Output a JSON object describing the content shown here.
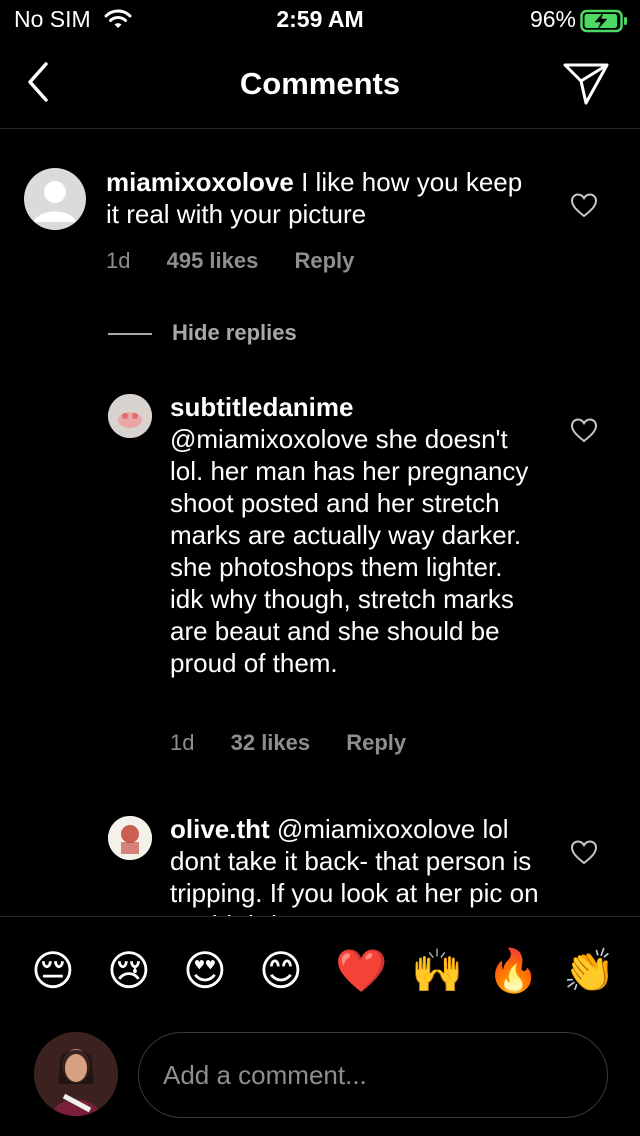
{
  "status": {
    "carrier": "No SIM",
    "time": "2:59 AM",
    "battery_pct": "96%",
    "battery_level": 0.96
  },
  "nav": {
    "title": "Comments"
  },
  "comments": [
    {
      "username": "miamixoxolove",
      "text": "I like how you keep it real with your picture",
      "age": "1d",
      "likes": "495 likes",
      "reply": "Reply"
    }
  ],
  "hide_replies": "Hide replies",
  "replies": [
    {
      "username": "subtitledanime",
      "text": "@miamixoxolove she doesn't lol. her man has her pregnancy shoot posted and her stretch marks are actually way darker. she photoshops them lighter. idk why though, stretch marks are beaut and she should be proud of them.",
      "age": "1d",
      "likes": "32 likes",
      "reply": "Reply"
    },
    {
      "username": "olive.tht",
      "text": "@miamixoxolove lol dont take it back- that person is tripping. If you look at her pic on my birthday",
      "age": "",
      "likes": "",
      "reply": ""
    }
  ],
  "emojis": [
    "😔",
    "😢",
    "😍",
    "😊",
    "❤️",
    "🙌",
    "🔥",
    "👏"
  ],
  "composer": {
    "placeholder": "Add a comment..."
  },
  "colors": {
    "background": "#000000",
    "muted": "#8e8e8e",
    "battery": "#4cd964"
  }
}
